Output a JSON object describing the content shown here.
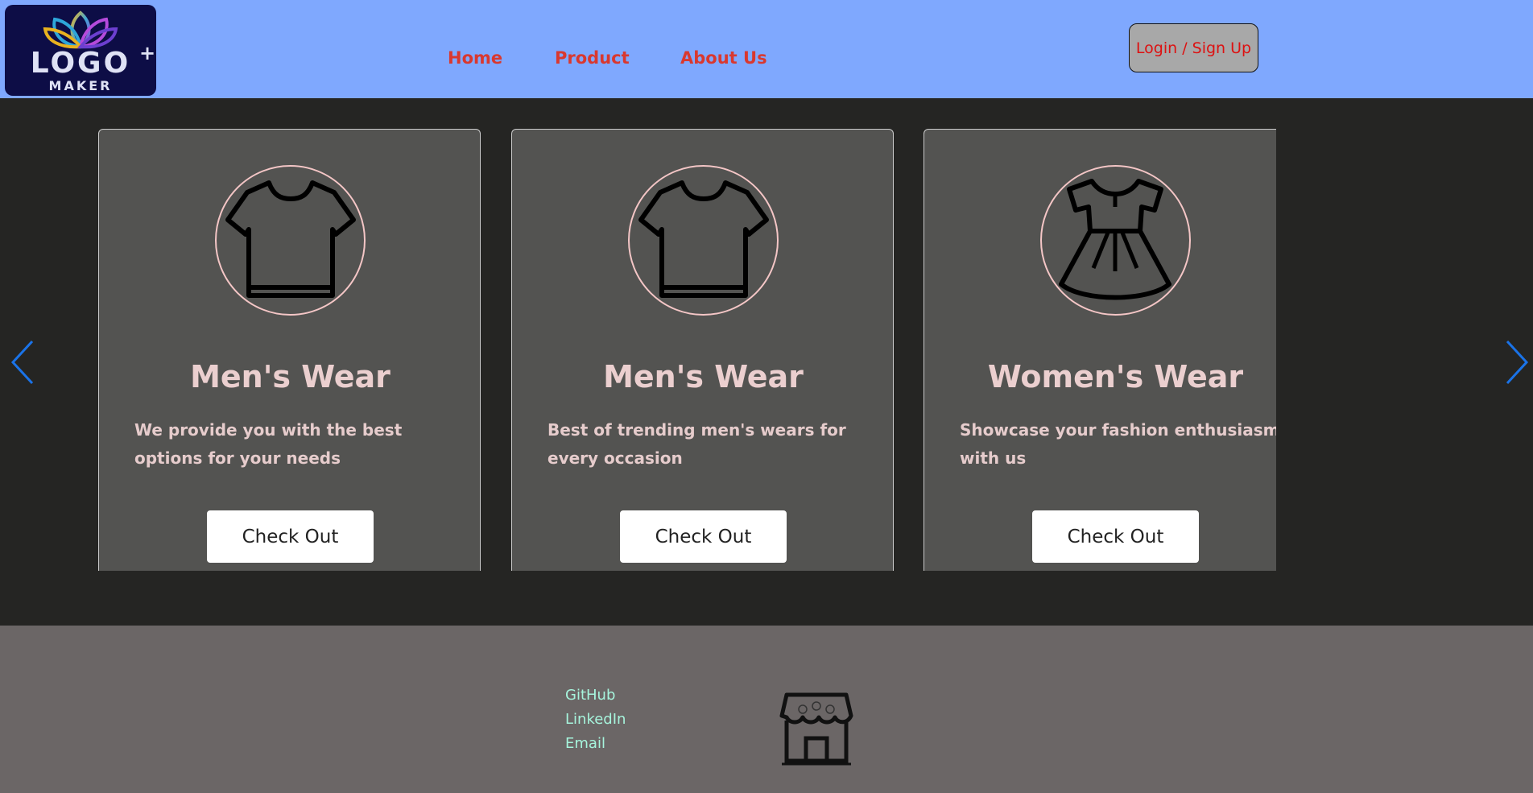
{
  "header": {
    "logo": {
      "main": "LOGO",
      "plus": "+",
      "sub": "MAKER"
    },
    "nav": [
      {
        "label": "Home"
      },
      {
        "label": "Product"
      },
      {
        "label": "About Us"
      }
    ],
    "login_label": "Login / Sign Up"
  },
  "carousel": {
    "cards": [
      {
        "title": "Men's Wear",
        "description": "We provide you with the best options for your needs",
        "button": "Check Out",
        "icon": "tshirt-icon"
      },
      {
        "title": "Men's Wear",
        "description": "Best of trending men's wears for every occasion",
        "button": "Check Out",
        "icon": "tshirt-icon"
      },
      {
        "title": "Women's Wear",
        "description": "Showcase your fashion enthusiasm with us",
        "button": "Check Out",
        "icon": "dress-icon"
      }
    ],
    "prev_icon": "chevron-left-icon",
    "next_icon": "chevron-right-icon"
  },
  "footer": {
    "links": [
      {
        "label": "GitHub"
      },
      {
        "label": "LinkedIn"
      },
      {
        "label": "Email"
      }
    ],
    "icon": "store-icon"
  },
  "colors": {
    "header_bg": "#7fa8fe",
    "nav_link": "#d9382f",
    "page_bg": "#252523",
    "card_bg": "#535351",
    "card_text": "#ebcfcf",
    "footer_bg": "#6b6666",
    "footer_link": "#a6f4dc",
    "arrow": "#1a73e8"
  }
}
